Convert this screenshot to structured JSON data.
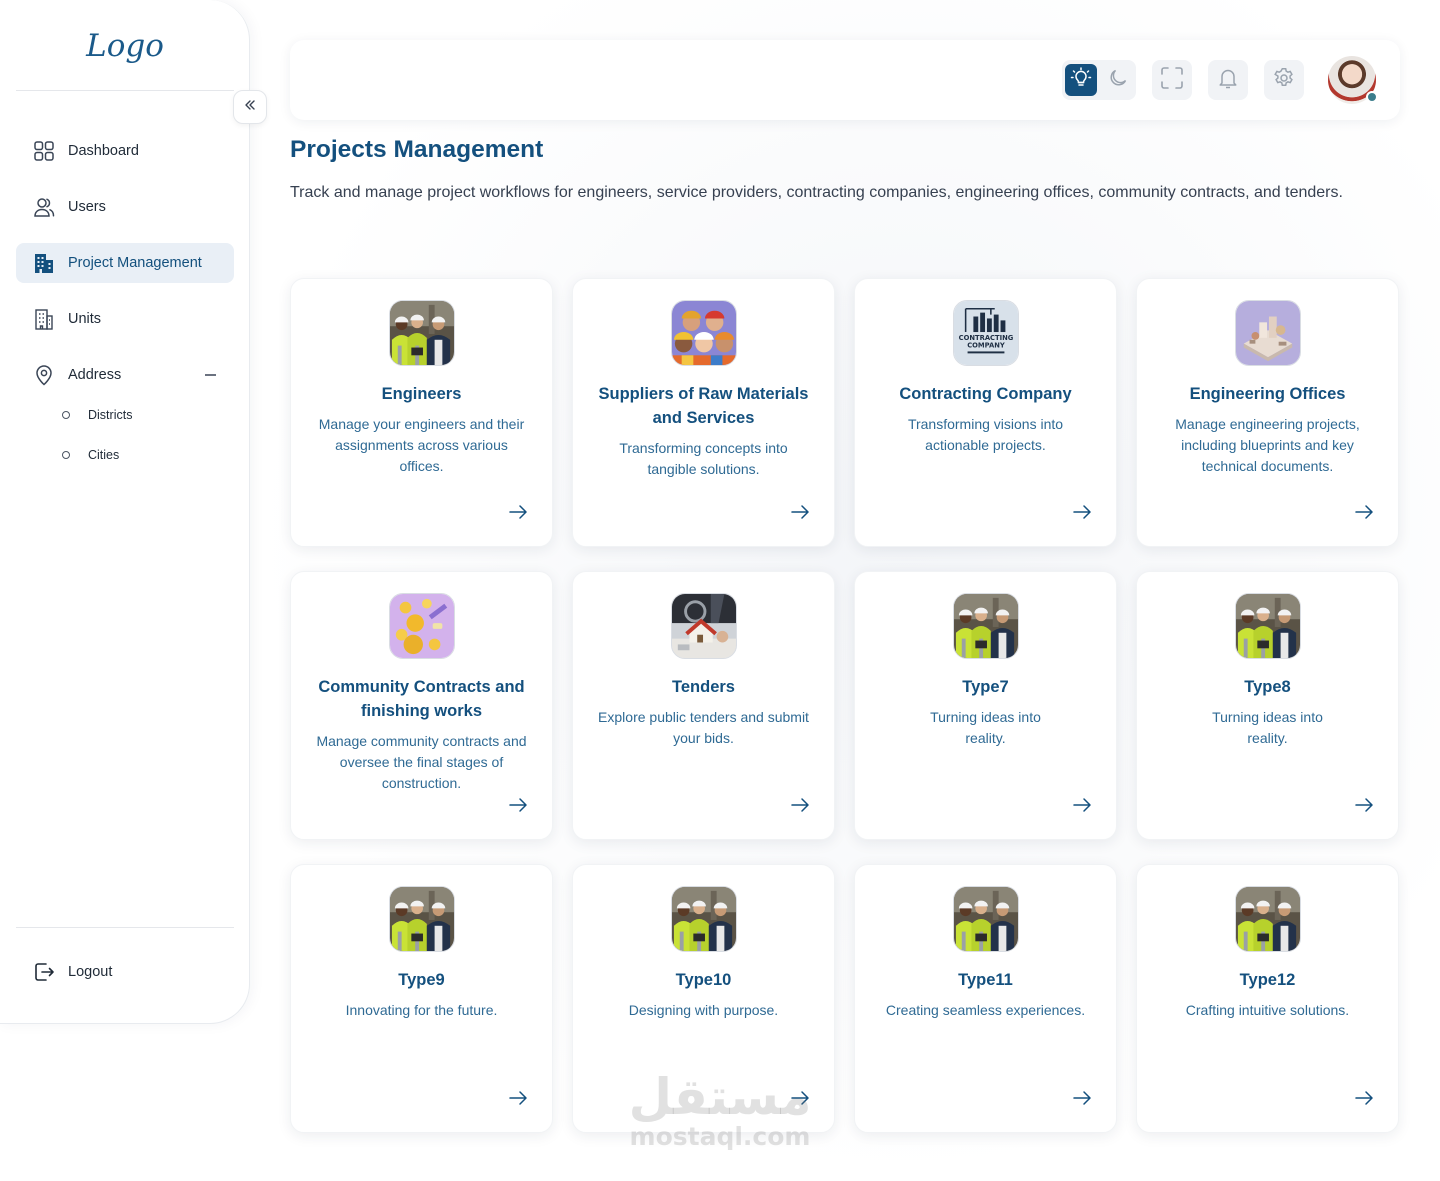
{
  "sidebar": {
    "logo": "Logo",
    "nav": [
      {
        "label": "Dashboard",
        "icon": "dashboard-grid-icon"
      },
      {
        "label": "Users",
        "icon": "users-icon"
      },
      {
        "label": "Project Management",
        "icon": "building-icon",
        "active": true
      },
      {
        "label": "Units",
        "icon": "units-building-icon"
      },
      {
        "label": "Address",
        "icon": "location-pin-icon",
        "expanded": true
      }
    ],
    "address_sub": [
      "Districts",
      "Cities"
    ],
    "logout": "Logout"
  },
  "topbar": {
    "icons": [
      "light-mode-icon",
      "dark-mode-icon",
      "fullscreen-icon",
      "bell-icon",
      "settings-gear-icon",
      "avatar"
    ]
  },
  "page": {
    "title": "Projects Management",
    "description": "Track and manage project workflows for engineers, service providers, contracting companies, engineering offices, community contracts, and tenders."
  },
  "cards": [
    {
      "title": "Engineers",
      "desc": "Manage your engineers and their assignments across various offices.",
      "image": "engineers-photo"
    },
    {
      "title": "Suppliers of Raw Materials and Services",
      "desc": "Transforming concepts into tangible solutions.",
      "image": "suppliers-illustration"
    },
    {
      "title": "Contracting Company",
      "desc": "Transforming visions into actionable projects.",
      "image": "contracting-company-logo"
    },
    {
      "title": "Engineering Offices",
      "desc": "Manage engineering projects, including blueprints and key technical documents.",
      "image": "engineering-offices-illustration"
    },
    {
      "title": "Community Contracts and finishing works",
      "desc": "Manage community contracts and oversee the final stages of construction.",
      "image": "community-contracts-illustration"
    },
    {
      "title": "Tenders",
      "desc": "Explore public tenders and submit your bids.",
      "image": "tenders-photo"
    },
    {
      "title": "Type7",
      "desc": "Turning ideas into reality.",
      "image": "engineers-photo"
    },
    {
      "title": "Type8",
      "desc": "Turning ideas into reality.",
      "image": "engineers-photo"
    },
    {
      "title": "Type9",
      "desc": "Innovating for the future.",
      "image": "engineers-photo"
    },
    {
      "title": "Type10",
      "desc": "Designing with purpose.",
      "image": "engineers-photo"
    },
    {
      "title": "Type11",
      "desc": "Creating seamless experiences.",
      "image": "engineers-photo"
    },
    {
      "title": "Type12",
      "desc": "Crafting intuitive solutions.",
      "image": "engineers-photo"
    }
  ],
  "watermark": {
    "arabic": "مستقل",
    "latin": "mostaql.com"
  },
  "colors": {
    "primary": "#14507e",
    "active_bg": "#e9eff6",
    "desc_text": "#2f6a94",
    "status_dot": "#3b7d8c"
  }
}
